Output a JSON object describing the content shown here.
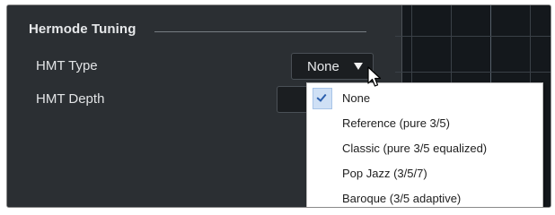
{
  "section": {
    "title": "Hermode Tuning"
  },
  "fields": {
    "type_label": "HMT Type",
    "type_value": "None",
    "depth_label": "HMT Depth"
  },
  "dropdown": {
    "selected_index": 0,
    "items": [
      {
        "label": "None"
      },
      {
        "label": "Reference (pure 3/5)"
      },
      {
        "label": "Classic (pure 3/5 equalized)"
      },
      {
        "label": "Pop Jazz (3/5/7)"
      },
      {
        "label": "Baroque (3/5 adaptive)"
      }
    ]
  },
  "icons": {
    "dropdown_arrow": "triangle-down-icon",
    "check": "checkmark-icon",
    "cursor": "mouse-pointer-icon"
  },
  "colors": {
    "panel_bg": "#2b2f33",
    "field_bg": "#1b1e21",
    "menu_bg": "#ffffff",
    "selected_highlight": "#cfe0f5",
    "editor_bg": "#14181c"
  }
}
